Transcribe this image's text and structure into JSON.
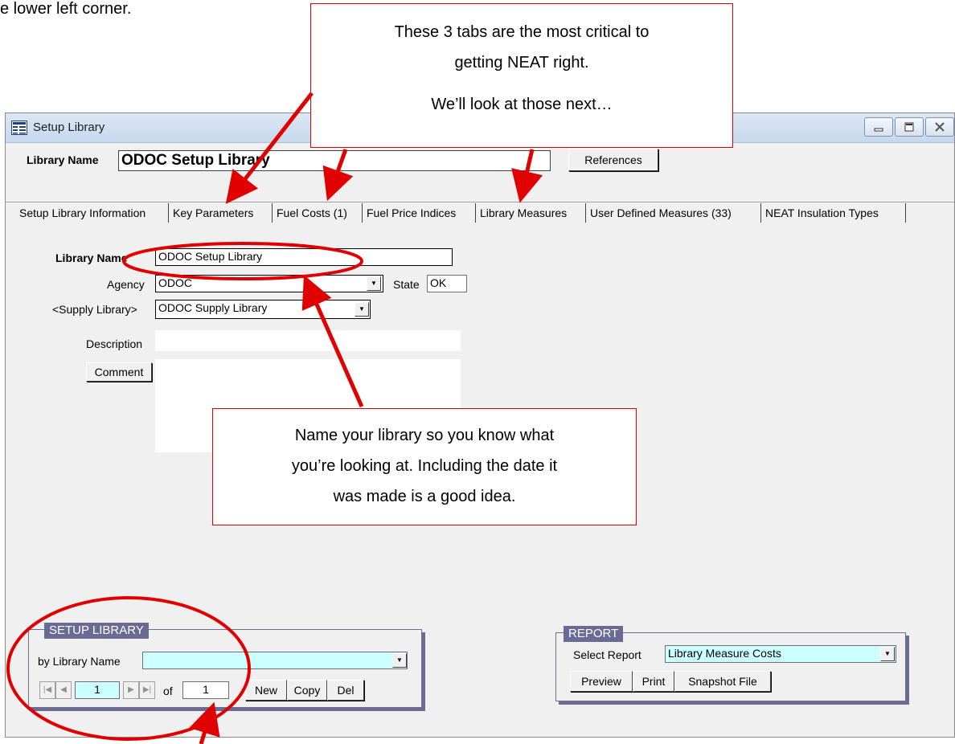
{
  "doc_text": "e lower left corner.",
  "window": {
    "title": "Setup Library",
    "header_label": "Library Name",
    "header_value": "ODOC Setup Library",
    "references_button": "References"
  },
  "tabs": [
    {
      "label": "Setup Library Information",
      "active": true
    },
    {
      "label": "Key Parameters"
    },
    {
      "label": "Fuel Costs (1)"
    },
    {
      "label": "Fuel Price Indices"
    },
    {
      "label": "Library Measures"
    },
    {
      "label": "User Defined Measures (33)"
    },
    {
      "label": "NEAT Insulation Types"
    }
  ],
  "form": {
    "library_name_label": "Library Name",
    "library_name_value": "ODOC Setup Library",
    "agency_label": "Agency",
    "agency_value": "ODOC",
    "state_label": "State",
    "state_value": "OK",
    "supply_library_label": "<Supply Library>",
    "supply_library_value": "ODOC Supply Library",
    "description_label": "Description",
    "description_value": "",
    "comment_button": "Comment"
  },
  "setup_library_group": {
    "title": "SETUP LIBRARY",
    "by_label": "by Library  Name",
    "by_value": "",
    "record_current": "1",
    "of_label": "of",
    "record_total": "1",
    "new_button": "New",
    "copy_button": "Copy",
    "del_button": "Del"
  },
  "report_group": {
    "title": "REPORT",
    "select_label": "Select Report",
    "select_value": "Library Measure Costs",
    "preview_button": "Preview",
    "print_button": "Print",
    "snapshot_button": "Snapshot File"
  },
  "callouts": {
    "tabs_line1": "These 3 tabs are the most critical to",
    "tabs_line2": "getting NEAT right.",
    "tabs_line3": "We’ll look at those next…",
    "name_line1": "Name your library so you know what",
    "name_line2": "you’re looking at. Including the date it",
    "name_line3": "was made is a good idea."
  },
  "colors": {
    "highlight_field": "#ccffff",
    "annotation_red": "#e00000",
    "group_header": "#6a6a95"
  }
}
